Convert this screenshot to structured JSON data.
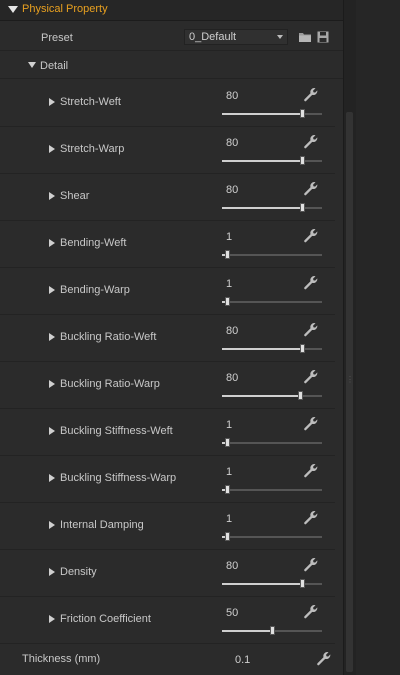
{
  "section": {
    "title": "Physical Property"
  },
  "preset": {
    "label": "Preset",
    "value": "0_Default"
  },
  "detail": {
    "label": "Detail"
  },
  "properties": [
    {
      "label": "Stretch-Weft",
      "value": "80",
      "level": 0.8
    },
    {
      "label": "Stretch-Warp",
      "value": "80",
      "level": 0.8
    },
    {
      "label": "Shear",
      "value": "80",
      "level": 0.8
    },
    {
      "label": "Bending-Weft",
      "value": "1",
      "level": 0.05
    },
    {
      "label": "Bending-Warp",
      "value": "1",
      "level": 0.05
    },
    {
      "label": "Buckling Ratio-Weft",
      "value": "80",
      "level": 0.8
    },
    {
      "label": "Buckling Ratio-Warp",
      "value": "80",
      "level": 0.78
    },
    {
      "label": "Buckling Stiffness-Weft",
      "value": "1",
      "level": 0.05
    },
    {
      "label": "Buckling Stiffness-Warp",
      "value": "1",
      "level": 0.05
    },
    {
      "label": "Internal Damping",
      "value": "1",
      "level": 0.05
    },
    {
      "label": "Density",
      "value": "80",
      "level": 0.8
    },
    {
      "label": "Friction Coefficient",
      "value": "50",
      "level": 0.5
    }
  ],
  "thickness": {
    "label": "Thickness (mm)",
    "value": "0.1"
  },
  "icons": {
    "folder": "folder-icon",
    "save": "save-icon",
    "wrench": "wrench-icon"
  },
  "colors": {
    "accent": "#e8a020",
    "panel": "#2b2b2b",
    "text": "#c8c8c8"
  }
}
